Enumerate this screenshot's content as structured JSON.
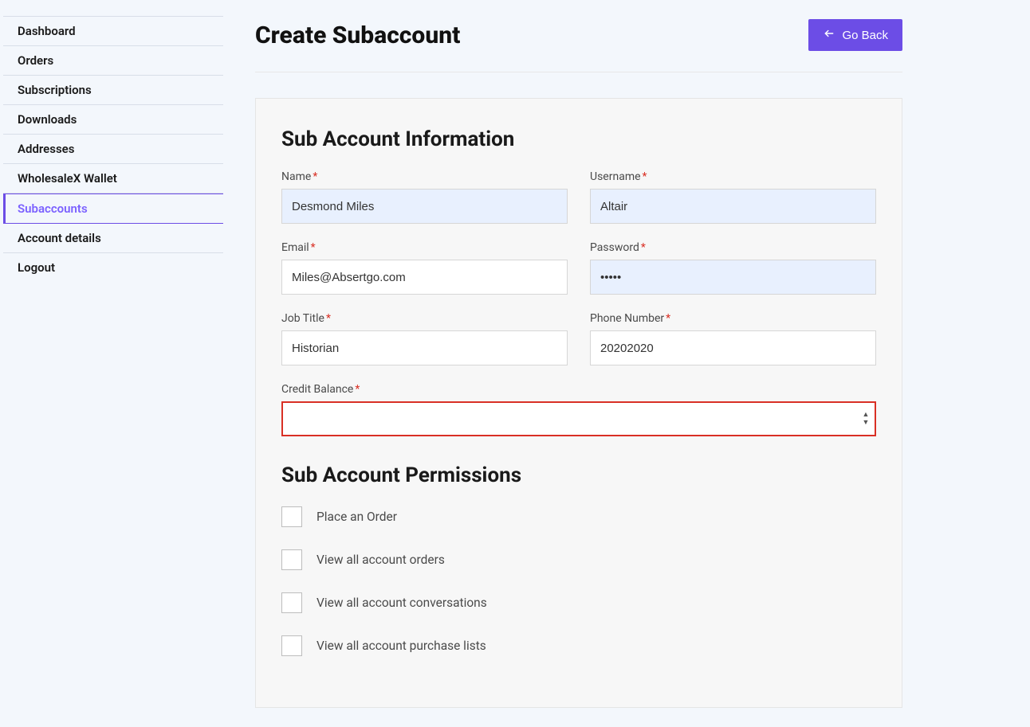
{
  "sidebar": {
    "items": [
      {
        "label": "Dashboard",
        "active": false
      },
      {
        "label": "Orders",
        "active": false
      },
      {
        "label": "Subscriptions",
        "active": false
      },
      {
        "label": "Downloads",
        "active": false
      },
      {
        "label": "Addresses",
        "active": false
      },
      {
        "label": "WholesaleX Wallet",
        "active": false
      },
      {
        "label": "Subaccounts",
        "active": true
      },
      {
        "label": "Account details",
        "active": false
      },
      {
        "label": "Logout",
        "active": false
      }
    ]
  },
  "header": {
    "title": "Create Subaccount",
    "go_back_label": "Go Back"
  },
  "form": {
    "section_info_heading": "Sub Account Information",
    "section_perms_heading": "Sub Account Permissions",
    "fields": {
      "name": {
        "label": "Name",
        "value": "Desmond Miles"
      },
      "username": {
        "label": "Username",
        "value": "Altair"
      },
      "email": {
        "label": "Email",
        "value": "Miles@Absertgo.com"
      },
      "password": {
        "label": "Password",
        "value": "•••••"
      },
      "job_title": {
        "label": "Job Title",
        "value": "Historian"
      },
      "phone": {
        "label": "Phone Number",
        "value": "20202020"
      },
      "credit_balance": {
        "label": "Credit Balance",
        "value": ""
      }
    },
    "permissions": [
      {
        "label": "Place an Order",
        "checked": false
      },
      {
        "label": "View all account orders",
        "checked": false
      },
      {
        "label": "View all account conversations",
        "checked": false
      },
      {
        "label": "View all account purchase lists",
        "checked": false
      }
    ]
  }
}
